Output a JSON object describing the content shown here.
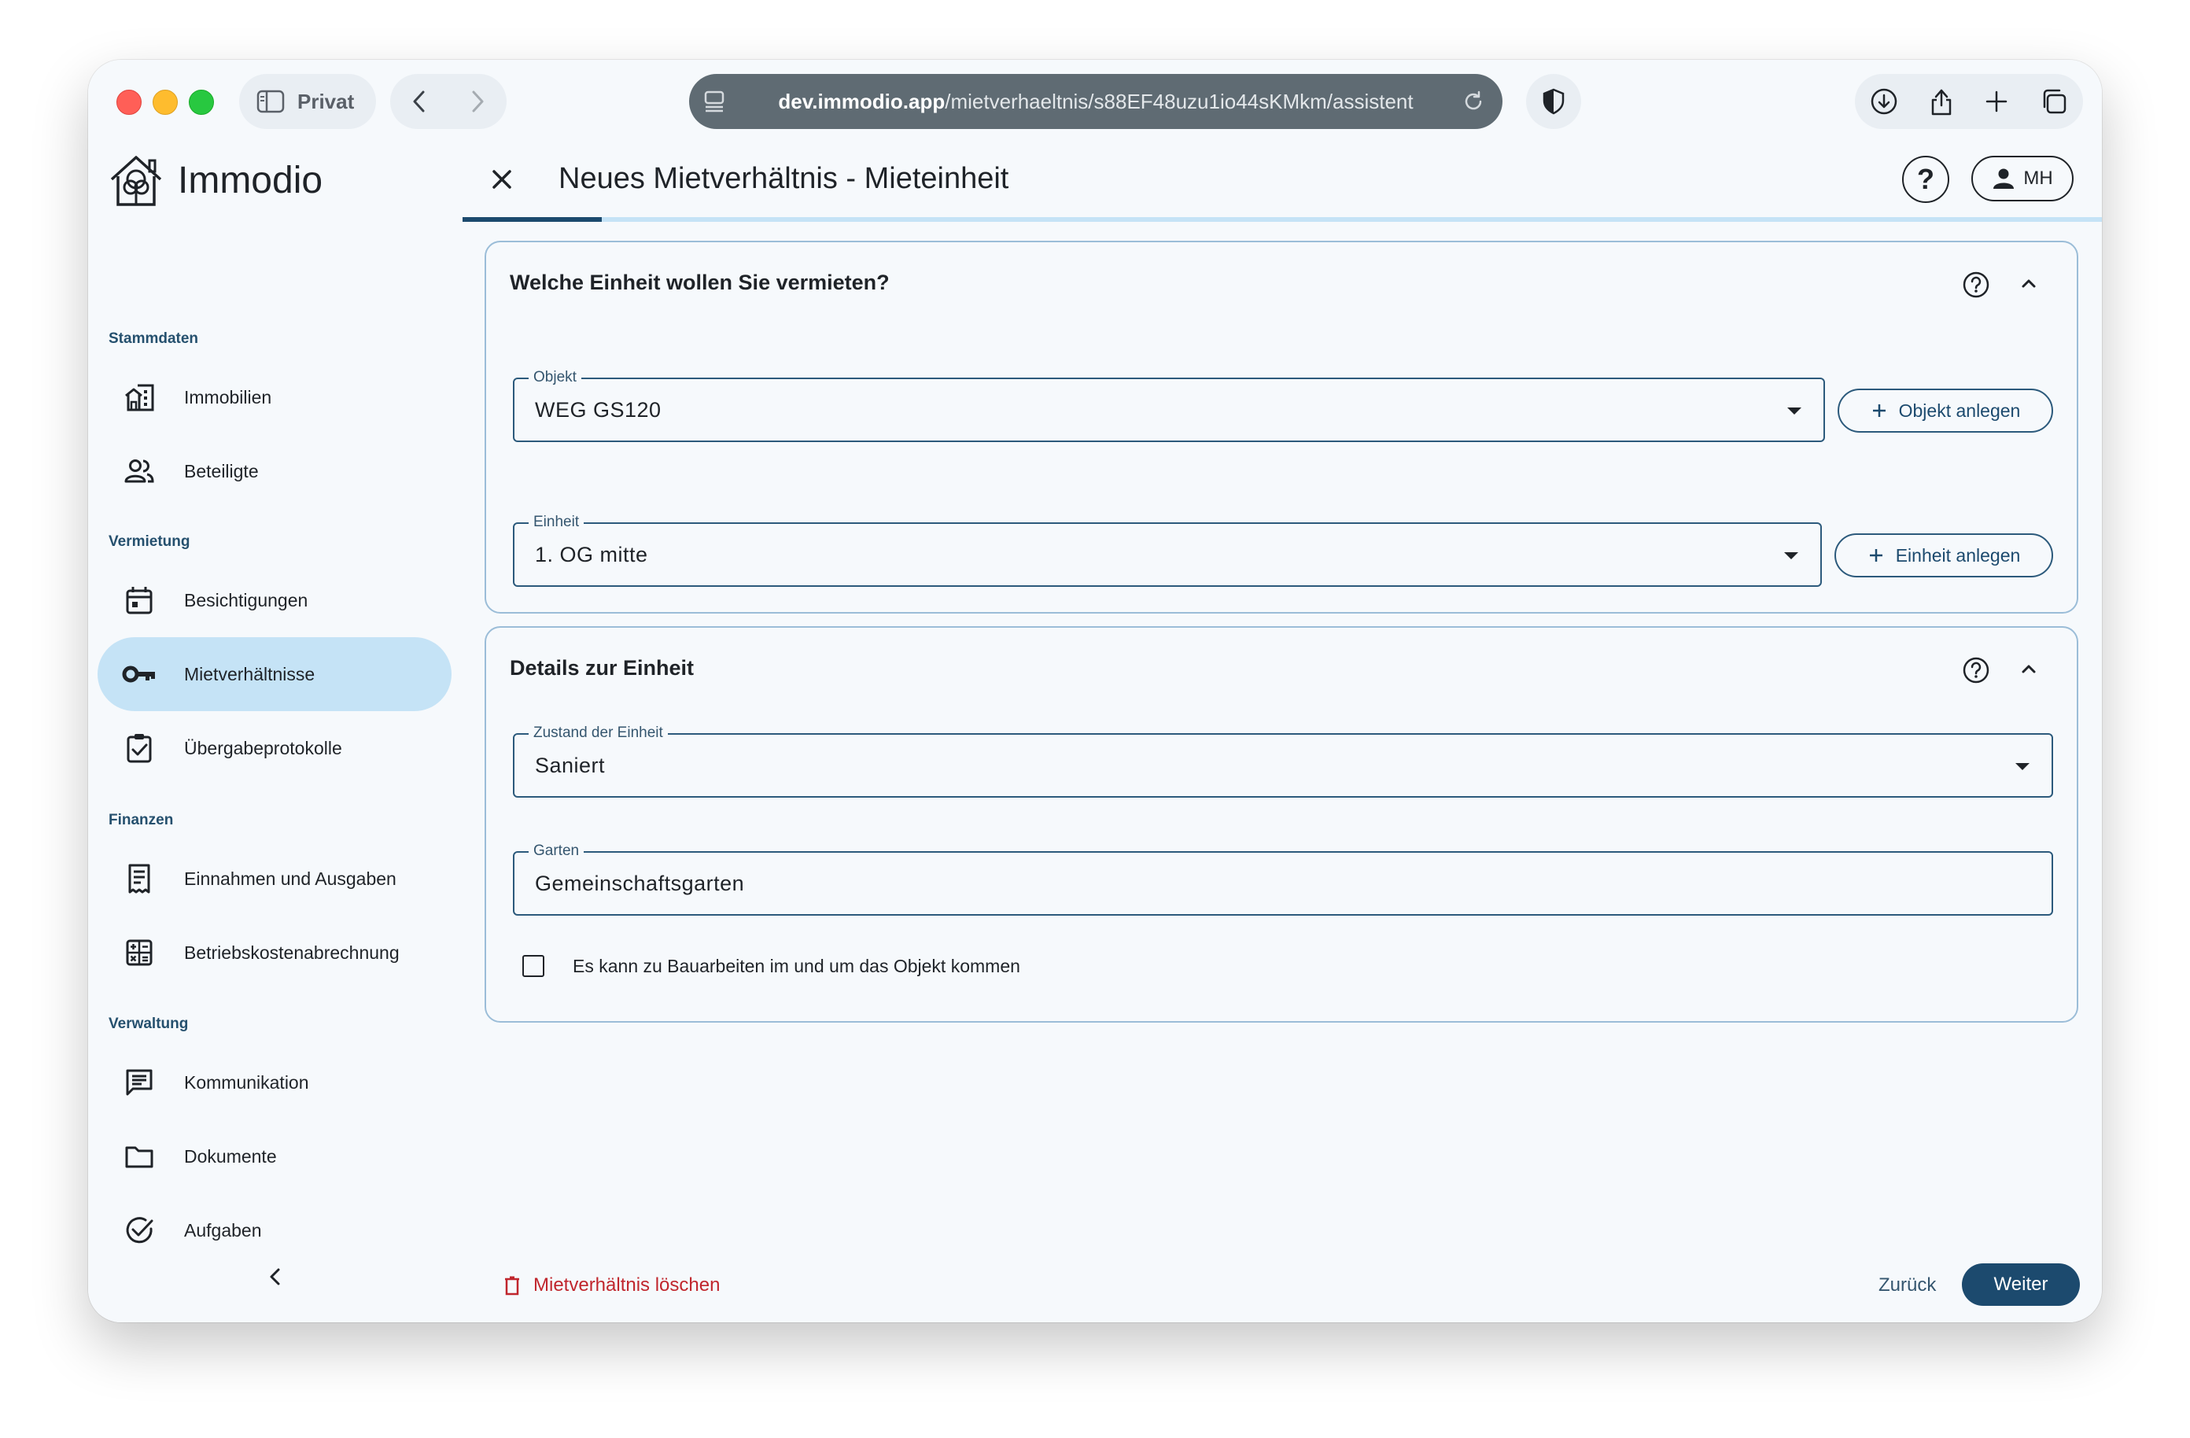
{
  "browser": {
    "profile_label": "Privat",
    "url_host": "dev.immodio.app",
    "url_path": "/mietverhaeltnis/s88EF48uzu1io44sKMkm/assistent"
  },
  "app": {
    "name": "Immodio"
  },
  "sidebar": {
    "sections": [
      {
        "title": "Stammdaten",
        "items": [
          {
            "label": "Immobilien",
            "icon": "building-icon"
          },
          {
            "label": "Beteiligte",
            "icon": "people-icon"
          }
        ]
      },
      {
        "title": "Vermietung",
        "items": [
          {
            "label": "Besichtigungen",
            "icon": "calendar-icon"
          },
          {
            "label": "Mietverhältnisse",
            "icon": "key-icon",
            "active": true
          },
          {
            "label": "Übergabeprotokolle",
            "icon": "clipboard-check-icon"
          }
        ]
      },
      {
        "title": "Finanzen",
        "items": [
          {
            "label": "Einnahmen und Ausgaben",
            "icon": "receipt-icon"
          },
          {
            "label": "Betriebskostenabrechnung",
            "icon": "calculator-icon"
          }
        ]
      },
      {
        "title": "Verwaltung",
        "items": [
          {
            "label": "Kommunikation",
            "icon": "message-icon"
          },
          {
            "label": "Dokumente",
            "icon": "folder-icon"
          },
          {
            "label": "Aufgaben",
            "icon": "check-circle-icon"
          }
        ]
      }
    ]
  },
  "header": {
    "title": "Neues Mietverhältnis - Mieteinheit",
    "help_symbol": "?",
    "user_initials": "MH",
    "progress_fraction": 0.085
  },
  "card_unit": {
    "title": "Welche Einheit wollen Sie vermieten?",
    "objekt_label": "Objekt",
    "objekt_value": "WEG GS120",
    "objekt_button": "Objekt anlegen",
    "einheit_label": "Einheit",
    "einheit_value": "1. OG mitte",
    "einheit_button": "Einheit anlegen"
  },
  "card_details": {
    "title": "Details zur Einheit",
    "zustand_label": "Zustand der Einheit",
    "zustand_value": "Saniert",
    "garten_label": "Garten",
    "garten_value": "Gemeinschaftsgarten",
    "checkbox_label": "Es kann zu Bauarbeiten im und um das Objekt kommen",
    "checkbox_checked": false
  },
  "footer": {
    "delete_label": "Mietverhältnis löschen",
    "back_label": "Zurück",
    "next_label": "Weiter"
  },
  "colors": {
    "accent": "#1c4a6e",
    "active_nav": "#c5e3f6",
    "danger": "#c0262d",
    "card_border": "#9bbdd8"
  }
}
